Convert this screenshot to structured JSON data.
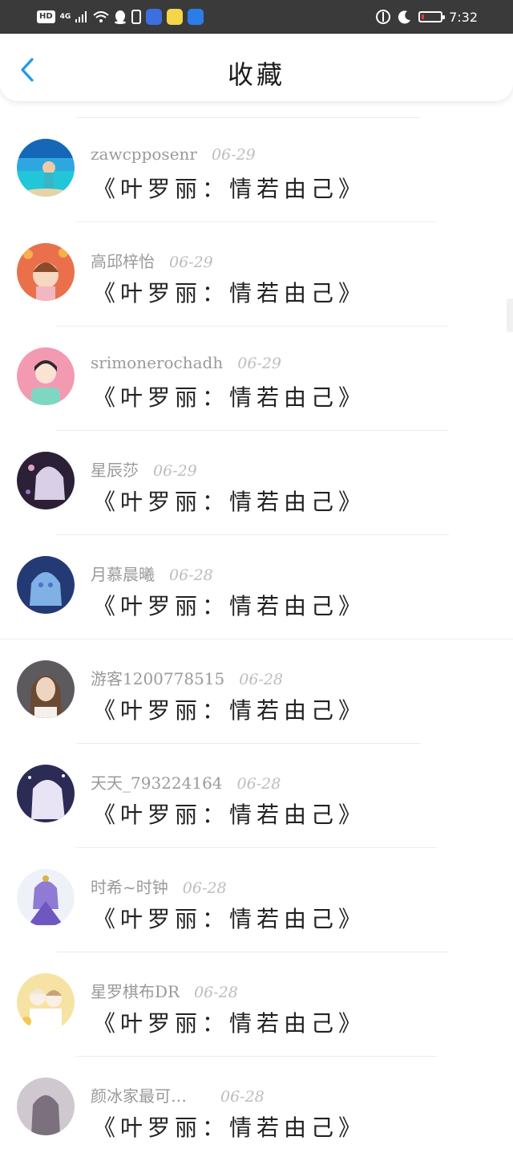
{
  "statusbar": {
    "hd": "HD",
    "network": "4G",
    "time": "7:32",
    "battery_level": 0.12,
    "battery_color": "#e53935"
  },
  "header": {
    "title": "收藏",
    "accent_color": "#1e9be8"
  },
  "items": [
    {
      "user": "zawcpposenr",
      "date": "06-29",
      "title": "《叶罗丽：情若由己》",
      "avatar": "beach"
    },
    {
      "user": "高邱梓怡",
      "date": "06-29",
      "title": "《叶罗丽：情若由己》",
      "avatar": "cartoon-2022"
    },
    {
      "user": "srimonerochadh",
      "date": "06-29",
      "title": "《叶罗丽：情若由己》",
      "avatar": "boy-pink"
    },
    {
      "user": "星辰莎",
      "date": "06-29",
      "title": "《叶罗丽：情若由己》",
      "avatar": "dark-anime"
    },
    {
      "user": "月慕晨曦",
      "date": "06-28",
      "title": "《叶罗丽：情若由己》",
      "avatar": "blue-anime"
    },
    {
      "user": "游客1200778515",
      "date": "06-28",
      "title": "《叶罗丽：情若由己》",
      "avatar": "girl-photo"
    },
    {
      "user": "天天_793224164",
      "date": "06-28",
      "title": "《叶罗丽：情若由己》",
      "avatar": "night-anime"
    },
    {
      "user": "时希~时钟",
      "date": "06-28",
      "title": "《叶罗丽：情若由己》",
      "avatar": "purple-doll"
    },
    {
      "user": "星罗棋布DR",
      "date": "06-28",
      "title": "《叶罗丽：情若由己》",
      "avatar": "couple-anime"
    },
    {
      "user": "颜冰家最可…",
      "date": "06-28",
      "title": "《叶罗丽：情若由己》",
      "avatar": "grey-photo"
    }
  ]
}
